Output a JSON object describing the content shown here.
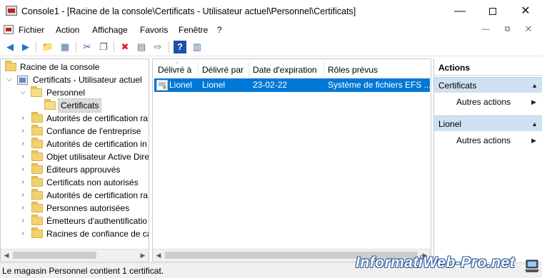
{
  "window": {
    "title": "Console1 - [Racine de la console\\Certificats - Utilisateur actuel\\Personnel\\Certificats]",
    "minimize_glyph": "—",
    "close_glyph": "✕"
  },
  "menubar": {
    "items": [
      "Fichier",
      "Action",
      "Affichage",
      "Favoris",
      "Fenêtre",
      "?"
    ],
    "mdi_controls": "— ⧉ ✕"
  },
  "toolbar": {
    "icons": [
      "back-arrow-icon",
      "forward-arrow-icon",
      "up-folder-icon",
      "show-hide-tree-icon",
      "cut-icon",
      "copy-icon",
      "delete-icon",
      "properties-icon",
      "export-icon",
      "help-icon",
      "show-hide-action-pane-icon"
    ],
    "glyphs": [
      "◀",
      "▶",
      "📁",
      "▦",
      "✂",
      "❐",
      "✖",
      "▤",
      "⇨",
      "?",
      "▥"
    ],
    "colors": {
      "back": "#1f6fd1",
      "forward": "#1f6fd1",
      "delete": "#d9232e",
      "help": "#1f4fa8"
    }
  },
  "tree": {
    "root": "Racine de la console",
    "snapin": "Certificats - Utilisateur actuel",
    "personnel": "Personnel",
    "certificats": "Certificats",
    "stores": [
      "Autorités de certification ra",
      "Confiance de l'entreprise",
      "Autorités de certification in",
      "Objet utilisateur Active Dire",
      "Éditeurs approuvés",
      "Certificats non autorisés",
      "Autorités de certification ra",
      "Personnes autorisées",
      "Émetteurs d'authentificatio",
      "Racines de confiance de ca"
    ]
  },
  "list": {
    "columns": [
      "Délivré à",
      "Délivré par",
      "Date d'expiration",
      "Rôles prévus"
    ],
    "rows": [
      {
        "issued_to": "Lionel",
        "issued_by": "Lionel",
        "expiration": "23-02-22",
        "roles": "Système de fichiers EFS ..."
      }
    ]
  },
  "actions": {
    "title": "Actions",
    "groups": [
      {
        "header": "Certificats",
        "item": "Autres actions"
      },
      {
        "header": "Lionel",
        "item": "Autres actions"
      }
    ]
  },
  "status": {
    "text": "Le magasin Personnel contient 1 certificat."
  },
  "watermark": "InformatiWeb-Pro.net",
  "colors": {
    "selection": "#0078d7",
    "action_group_header": "#cfe0f2",
    "folder": "#f2d16f"
  }
}
